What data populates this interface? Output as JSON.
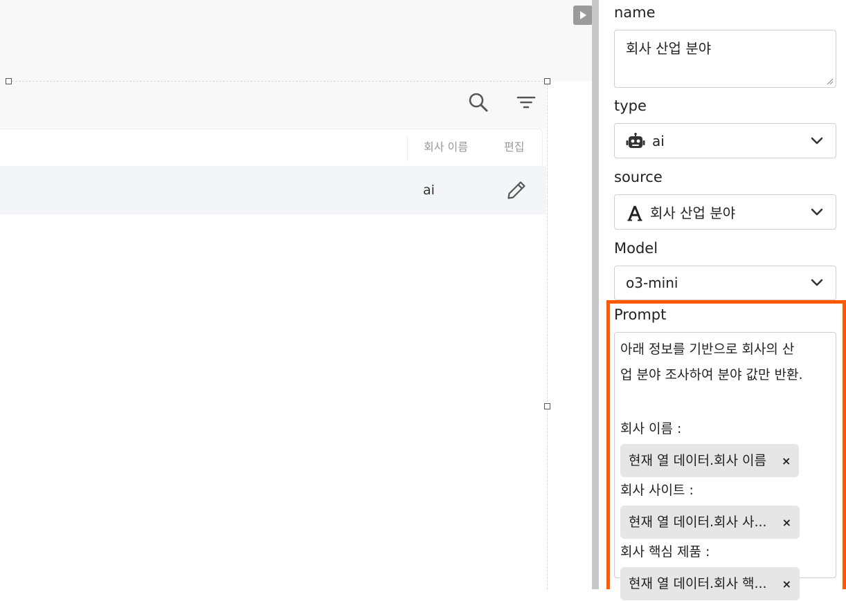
{
  "table": {
    "columns": [
      "회사 이름",
      "편집"
    ],
    "rows": [
      {
        "company_name": "ai"
      }
    ]
  },
  "icons": {
    "search": "search-icon",
    "filter": "filter-icon",
    "edit": "pencil-icon",
    "collapse": "play-triangle-icon",
    "type": "robot-icon",
    "source": "font-a-icon",
    "dropdown": "chevron-down-icon"
  },
  "panel": {
    "name": {
      "label": "name",
      "value": "회사 산업 분야"
    },
    "type": {
      "label": "type",
      "value": "ai"
    },
    "source": {
      "label": "source",
      "value": "회사 산업 분야"
    },
    "model": {
      "label": "Model",
      "value": "o3-mini"
    },
    "prompt": {
      "label": "Prompt",
      "lines": [
        "아래 정보를 기반으로 회사의 산",
        "업 분야 조사하여 분야 값만 반환."
      ],
      "vars": [
        {
          "label": "회사 이름 :",
          "chip": "현재 열 데이터.회사 이름",
          "remove": "×"
        },
        {
          "label": "회사 사이트 :",
          "chip": "현재 열 데이터.회사 사...",
          "remove": "×"
        },
        {
          "label": "회사 핵심 제품 :",
          "chip": "현재 열 데이터.회사 핵...",
          "remove": "×"
        }
      ]
    }
  },
  "colors": {
    "highlight": "#ff5a00",
    "divider": "#c8c8c8",
    "row_bg": "#f4f5f9",
    "chip_bg": "#e6e6e6"
  }
}
